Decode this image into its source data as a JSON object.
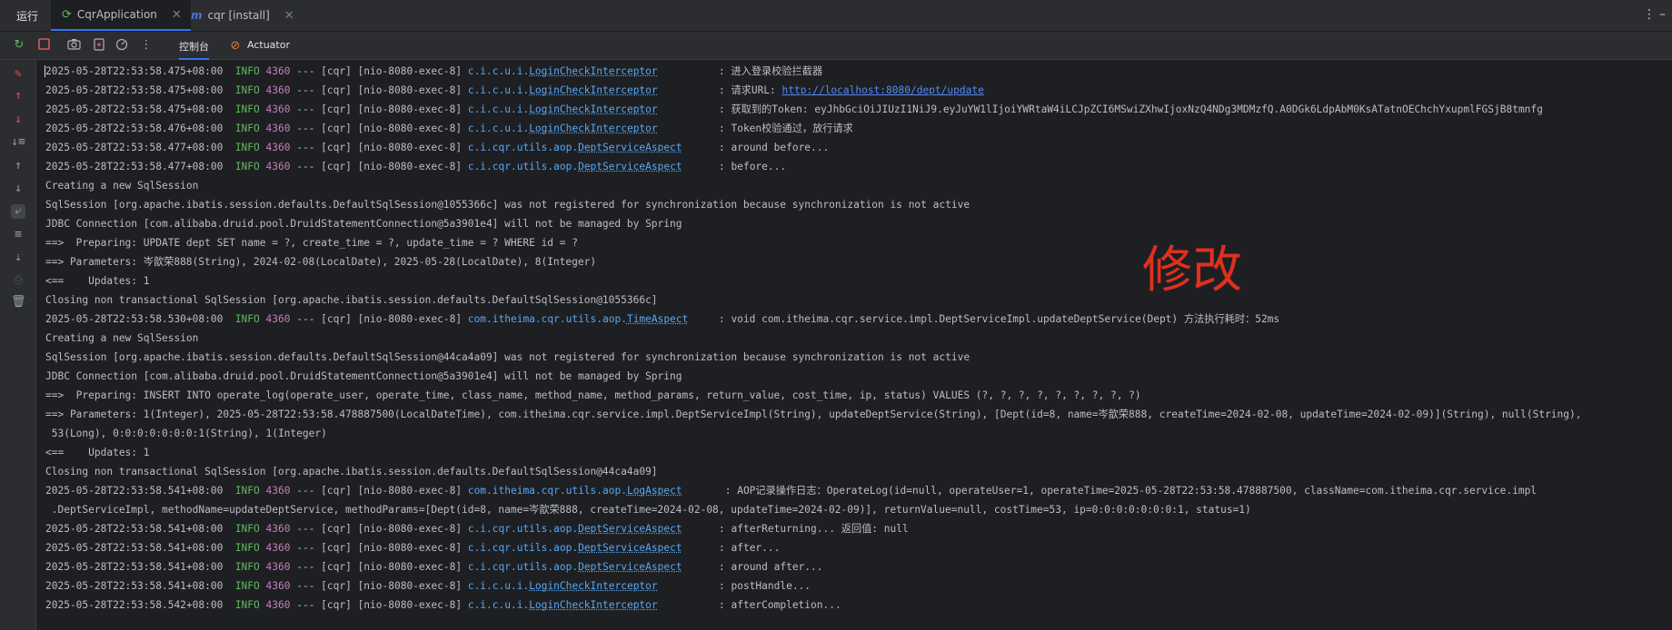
{
  "tabbar": {
    "run_label": "运行",
    "tabs": [
      {
        "label": "CqrApplication",
        "active": true
      },
      {
        "label": "cqr [install]",
        "active": false
      }
    ]
  },
  "toolbar": {
    "console_tab": "控制台",
    "actuator_tab": "Actuator"
  },
  "overlay_text": "修改",
  "colors": {
    "background": "#1e1f22",
    "info": "#5fb85f",
    "pid": "#c77dbb",
    "logger": "#56a8f5",
    "overlay": "#e0301e"
  },
  "log_lines": [
    {
      "type": "log",
      "ts": "2025-05-28T22:53:58.475+08:00",
      "lvl": "INFO",
      "pid": "4360",
      "thread": "--- [cqr] [nio-8080-exec-8]",
      "logger_pre": "c.i.c.u.i.",
      "logger_cls": "LoginCheckInterceptor",
      "pad": "         ",
      "msg": ": 进入登录校验拦截器"
    },
    {
      "type": "log",
      "ts": "2025-05-28T22:53:58.475+08:00",
      "lvl": "INFO",
      "pid": "4360",
      "thread": "--- [cqr] [nio-8080-exec-8]",
      "logger_pre": "c.i.c.u.i.",
      "logger_cls": "LoginCheckInterceptor",
      "pad": "         ",
      "msg": ": 请求URL: ",
      "link": "http://localhost:8080/dept/update"
    },
    {
      "type": "log",
      "ts": "2025-05-28T22:53:58.475+08:00",
      "lvl": "INFO",
      "pid": "4360",
      "thread": "--- [cqr] [nio-8080-exec-8]",
      "logger_pre": "c.i.c.u.i.",
      "logger_cls": "LoginCheckInterceptor",
      "pad": "         ",
      "msg": ": 获取到的Token: eyJhbGciOiJIUzI1NiJ9.eyJuYW1lIjoiYWRtaW4iLCJpZCI6MSwiZXhwIjoxNzQ4NDg3MDMzfQ.A0DGk6LdpAbM0KsATatnOEChchYxupmlFGSjB8tmnfg"
    },
    {
      "type": "log",
      "ts": "2025-05-28T22:53:58.476+08:00",
      "lvl": "INFO",
      "pid": "4360",
      "thread": "--- [cqr] [nio-8080-exec-8]",
      "logger_pre": "c.i.c.u.i.",
      "logger_cls": "LoginCheckInterceptor",
      "pad": "         ",
      "msg": ": Token校验通过，放行请求"
    },
    {
      "type": "log",
      "ts": "2025-05-28T22:53:58.477+08:00",
      "lvl": "INFO",
      "pid": "4360",
      "thread": "--- [cqr] [nio-8080-exec-8]",
      "logger_pre": "c.i.cqr.utils.aop.",
      "logger_cls": "DeptServiceAspect",
      "pad": "     ",
      "msg": ": around before..."
    },
    {
      "type": "log",
      "ts": "2025-05-28T22:53:58.477+08:00",
      "lvl": "INFO",
      "pid": "4360",
      "thread": "--- [cqr] [nio-8080-exec-8]",
      "logger_pre": "c.i.cqr.utils.aop.",
      "logger_cls": "DeptServiceAspect",
      "pad": "     ",
      "msg": ": before..."
    },
    {
      "type": "plain",
      "text": "Creating a new SqlSession"
    },
    {
      "type": "plain",
      "text": "SqlSession [org.apache.ibatis.session.defaults.DefaultSqlSession@1055366c] was not registered for synchronization because synchronization is not active"
    },
    {
      "type": "plain",
      "text": "JDBC Connection [com.alibaba.druid.pool.DruidStatementConnection@5a3901e4] will not be managed by Spring"
    },
    {
      "type": "plain",
      "text": "==>  Preparing: UPDATE dept SET name = ?, create_time = ?, update_time = ? WHERE id = ?"
    },
    {
      "type": "plain",
      "text": "==> Parameters: 岑歆荣888(String), 2024-02-08(LocalDate), 2025-05-28(LocalDate), 8(Integer)"
    },
    {
      "type": "plain",
      "text": "<==    Updates: 1"
    },
    {
      "type": "plain",
      "text": "Closing non transactional SqlSession [org.apache.ibatis.session.defaults.DefaultSqlSession@1055366c]"
    },
    {
      "type": "log",
      "ts": "2025-05-28T22:53:58.530+08:00",
      "lvl": "INFO",
      "pid": "4360",
      "thread": "--- [cqr] [nio-8080-exec-8]",
      "logger_pre": "com.itheima.cqr.utils.aop.",
      "logger_cls": "TimeAspect",
      "pad": "    ",
      "msg": ": void com.itheima.cqr.service.impl.DeptServiceImpl.updateDeptService(Dept) 方法执行耗时：52ms"
    },
    {
      "type": "plain",
      "text": "Creating a new SqlSession"
    },
    {
      "type": "plain",
      "text": "SqlSession [org.apache.ibatis.session.defaults.DefaultSqlSession@44ca4a09] was not registered for synchronization because synchronization is not active"
    },
    {
      "type": "plain",
      "text": "JDBC Connection [com.alibaba.druid.pool.DruidStatementConnection@5a3901e4] will not be managed by Spring"
    },
    {
      "type": "plain",
      "text": "==>  Preparing: INSERT INTO operate_log(operate_user, operate_time, class_name, method_name, method_params, return_value, cost_time, ip, status) VALUES (?, ?, ?, ?, ?, ?, ?, ?, ?)"
    },
    {
      "type": "plain",
      "text": "==> Parameters: 1(Integer), 2025-05-28T22:53:58.478887500(LocalDateTime), com.itheima.cqr.service.impl.DeptServiceImpl(String), updateDeptService(String), [Dept(id=8, name=岑歆荣888, createTime=2024-02-08, updateTime=2024-02-09)](String), null(String),"
    },
    {
      "type": "plain",
      "text": " 53(Long), 0:0:0:0:0:0:0:1(String), 1(Integer)"
    },
    {
      "type": "plain",
      "text": "<==    Updates: 1"
    },
    {
      "type": "plain",
      "text": "Closing non transactional SqlSession [org.apache.ibatis.session.defaults.DefaultSqlSession@44ca4a09]"
    },
    {
      "type": "log",
      "ts": "2025-05-28T22:53:58.541+08:00",
      "lvl": "INFO",
      "pid": "4360",
      "thread": "--- [cqr] [nio-8080-exec-8]",
      "logger_pre": "com.itheima.cqr.utils.aop.",
      "logger_cls": "LogAspect",
      "pad": "      ",
      "msg": ": AOP记录操作日志：OperateLog(id=null, operateUser=1, operateTime=2025-05-28T22:53:58.478887500, className=com.itheima.cqr.service.impl"
    },
    {
      "type": "plain",
      "text": " .DeptServiceImpl, methodName=updateDeptService, methodParams=[Dept(id=8, name=岑歆荣888, createTime=2024-02-08, updateTime=2024-02-09)], returnValue=null, costTime=53, ip=0:0:0:0:0:0:0:1, status=1)"
    },
    {
      "type": "log",
      "ts": "2025-05-28T22:53:58.541+08:00",
      "lvl": "INFO",
      "pid": "4360",
      "thread": "--- [cqr] [nio-8080-exec-8]",
      "logger_pre": "c.i.cqr.utils.aop.",
      "logger_cls": "DeptServiceAspect",
      "pad": "     ",
      "msg": ": afterReturning... 返回值: null"
    },
    {
      "type": "log",
      "ts": "2025-05-28T22:53:58.541+08:00",
      "lvl": "INFO",
      "pid": "4360",
      "thread": "--- [cqr] [nio-8080-exec-8]",
      "logger_pre": "c.i.cqr.utils.aop.",
      "logger_cls": "DeptServiceAspect",
      "pad": "     ",
      "msg": ": after..."
    },
    {
      "type": "log",
      "ts": "2025-05-28T22:53:58.541+08:00",
      "lvl": "INFO",
      "pid": "4360",
      "thread": "--- [cqr] [nio-8080-exec-8]",
      "logger_pre": "c.i.cqr.utils.aop.",
      "logger_cls": "DeptServiceAspect",
      "pad": "     ",
      "msg": ": around after..."
    },
    {
      "type": "log",
      "ts": "2025-05-28T22:53:58.541+08:00",
      "lvl": "INFO",
      "pid": "4360",
      "thread": "--- [cqr] [nio-8080-exec-8]",
      "logger_pre": "c.i.c.u.i.",
      "logger_cls": "LoginCheckInterceptor",
      "pad": "         ",
      "msg": ": postHandle..."
    },
    {
      "type": "log",
      "ts": "2025-05-28T22:53:58.542+08:00",
      "lvl": "INFO",
      "pid": "4360",
      "thread": "--- [cqr] [nio-8080-exec-8]",
      "logger_pre": "c.i.c.u.i.",
      "logger_cls": "LoginCheckInterceptor",
      "pad": "         ",
      "msg": ": afterCompletion..."
    }
  ]
}
